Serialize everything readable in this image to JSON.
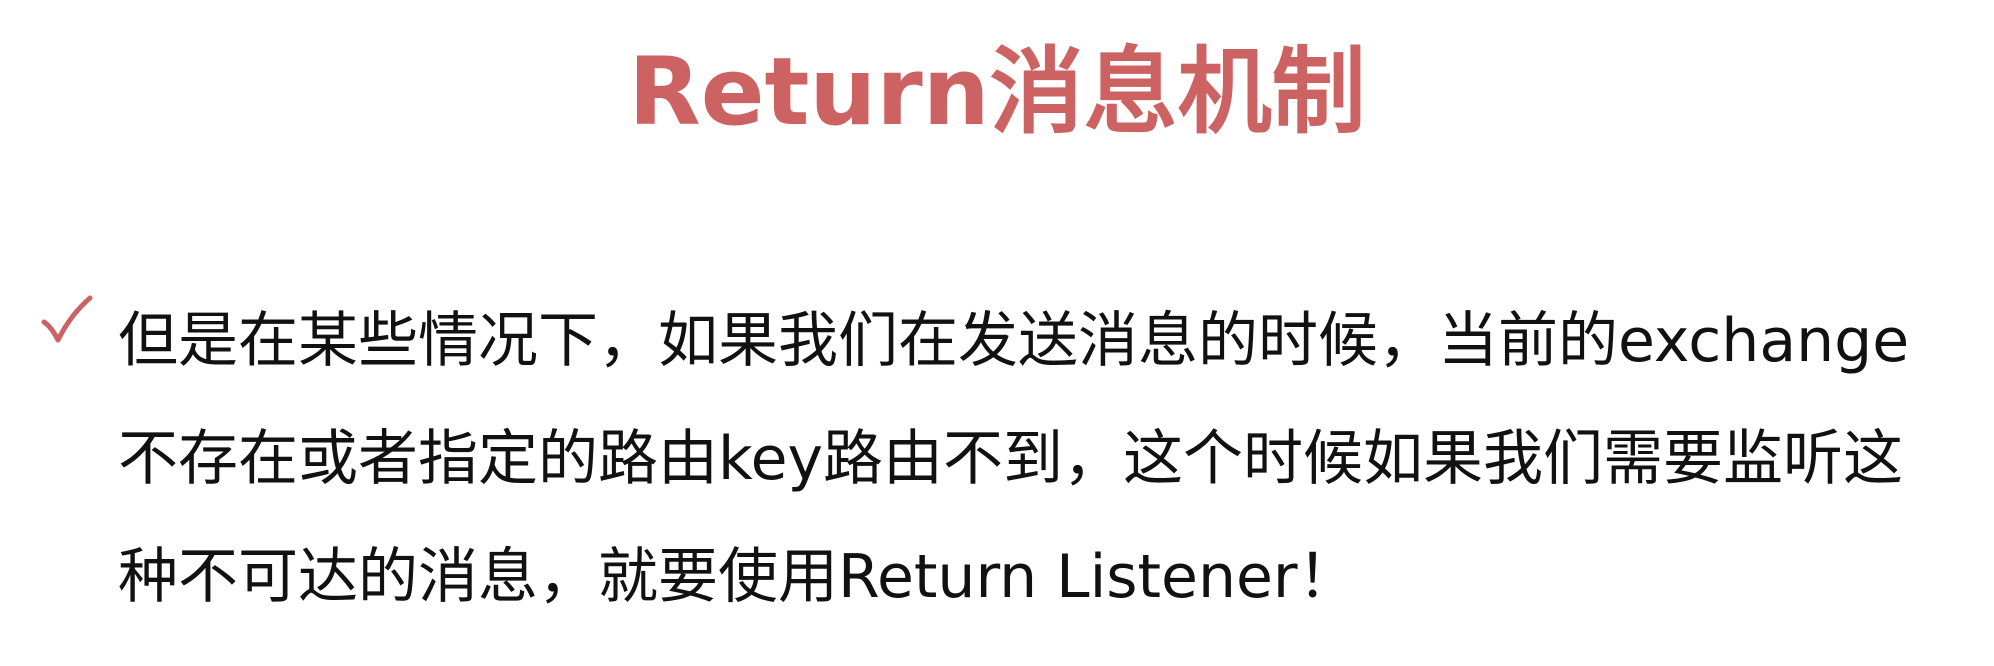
{
  "slide": {
    "title": "Return消息机制",
    "bullet_icon": "check-mark-icon",
    "accent_color": "#cc6262",
    "text_color": "#111111",
    "body_lines": [
      "但是在某些情况下，如果我们在发送消息的时候，当前的exchange",
      "不存在或者指定的路由key路由不到，这个时候如果我们需要监听这",
      "种不可达的消息，就要使用Return Listener！"
    ]
  }
}
